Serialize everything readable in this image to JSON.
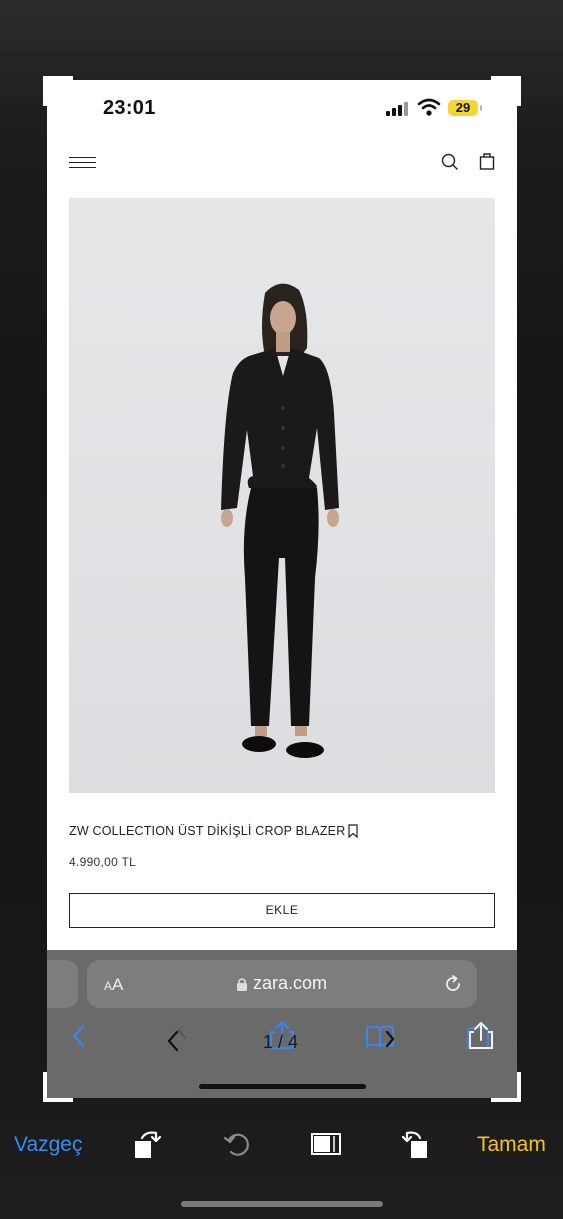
{
  "status_bar": {
    "time": "23:01",
    "battery": "29"
  },
  "product": {
    "title": "ZW COLLECTION ÜST DİKİŞLİ CROP BLAZER",
    "price": "4.990,00 TL",
    "add_label": "EKLE"
  },
  "browser": {
    "aa_label_small": "A",
    "aa_label_big": "A",
    "domain": "zara.com",
    "page_counter": "1 / 4"
  },
  "editor": {
    "cancel_label": "Vazgeç",
    "done_label": "Tamam"
  },
  "colors": {
    "cancel": "#3b8cf1",
    "done": "#f5c421",
    "battery": "#f4d532",
    "link": "#3a86ee"
  }
}
